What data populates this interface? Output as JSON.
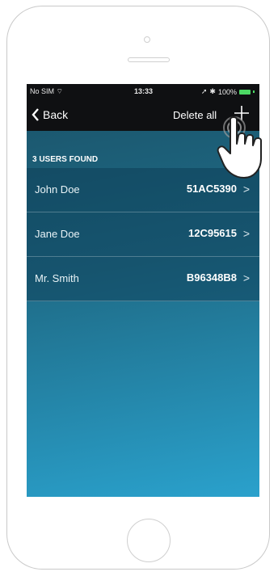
{
  "statusbar": {
    "carrier": "No SIM",
    "time": "13:33",
    "battery": "100%"
  },
  "navbar": {
    "back_label": "Back",
    "delete_all_label": "Delete all"
  },
  "section_title": "3 USERS FOUND",
  "users": [
    {
      "name": "John Doe",
      "code": "51AC5390"
    },
    {
      "name": "Jane Doe",
      "code": "12C95615"
    },
    {
      "name": "Mr. Smith",
      "code": "B96348B8"
    }
  ],
  "icons": {
    "back": "chevron-left-icon",
    "add": "plus-icon",
    "row": "chevron-right-icon",
    "pointer": "hand-pointer-icon"
  },
  "colors": {
    "navbar_bg": "#0f1012",
    "gradient_top": "#1a5268",
    "gradient_bottom": "#2aa1cc",
    "battery": "#4cd964"
  }
}
